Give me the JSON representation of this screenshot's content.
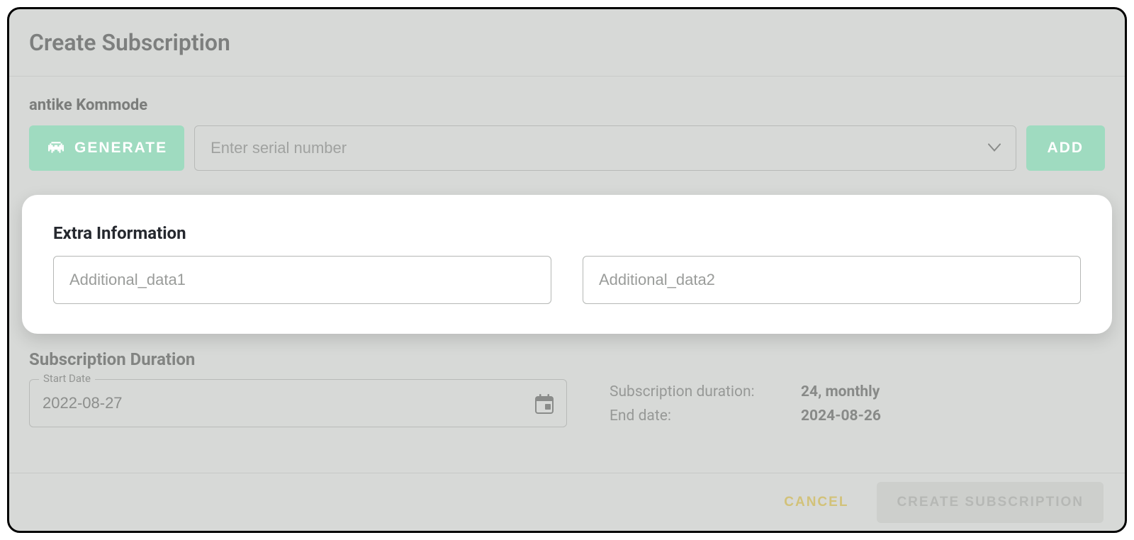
{
  "dialog": {
    "title": "Create Subscription",
    "item_name": "antike Kommode",
    "generate_label": "GENERATE",
    "serial_placeholder": "Enter serial number",
    "serial_value": "",
    "add_label": "ADD"
  },
  "extra": {
    "title": "Extra Information",
    "field1_placeholder": "Additional_data1",
    "field1_value": "",
    "field2_placeholder": "Additional_data2",
    "field2_value": ""
  },
  "duration": {
    "title": "Subscription Duration",
    "start_date_label": "Start Date",
    "start_date_value": "2022-08-27",
    "duration_label": "Subscription duration:",
    "duration_value": "24, monthly",
    "end_date_label": "End date:",
    "end_date_value": "2024-08-26"
  },
  "footer": {
    "cancel_label": "CANCEL",
    "create_label": "CREATE SUBSCRIPTION"
  },
  "colors": {
    "accent_green": "#9fdbc0",
    "accent_yellow": "#d2c279",
    "dim_bg": "#d7d9d7"
  }
}
